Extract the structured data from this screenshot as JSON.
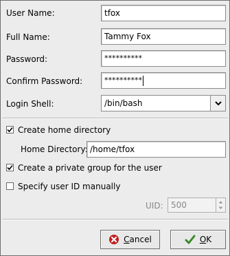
{
  "form": {
    "user_name": {
      "label": "User Name:",
      "value": "tfox"
    },
    "full_name": {
      "label": "Full Name:",
      "value": "Tammy Fox"
    },
    "password": {
      "label": "Password:",
      "value": "**********"
    },
    "confirm_password": {
      "label": "Confirm Password:",
      "value": "**********"
    },
    "login_shell": {
      "label": "Login Shell:",
      "value": "/bin/bash"
    }
  },
  "home": {
    "create_label": "Create home directory",
    "create_checked": true,
    "dir_label": "Home Directory:",
    "dir_value": "/home/tfox"
  },
  "private_group": {
    "label": "Create a private group for the user",
    "checked": true
  },
  "manual_uid": {
    "label": "Specify user ID manually",
    "checked": false
  },
  "uid": {
    "label": "UID:",
    "value": "500"
  },
  "buttons": {
    "cancel_first": "C",
    "cancel_rest": "ancel",
    "ok_first": "O",
    "ok_rest": "K"
  },
  "colors": {
    "cancel_icon": "#c02020",
    "ok_icon": "#3a8a2a"
  }
}
